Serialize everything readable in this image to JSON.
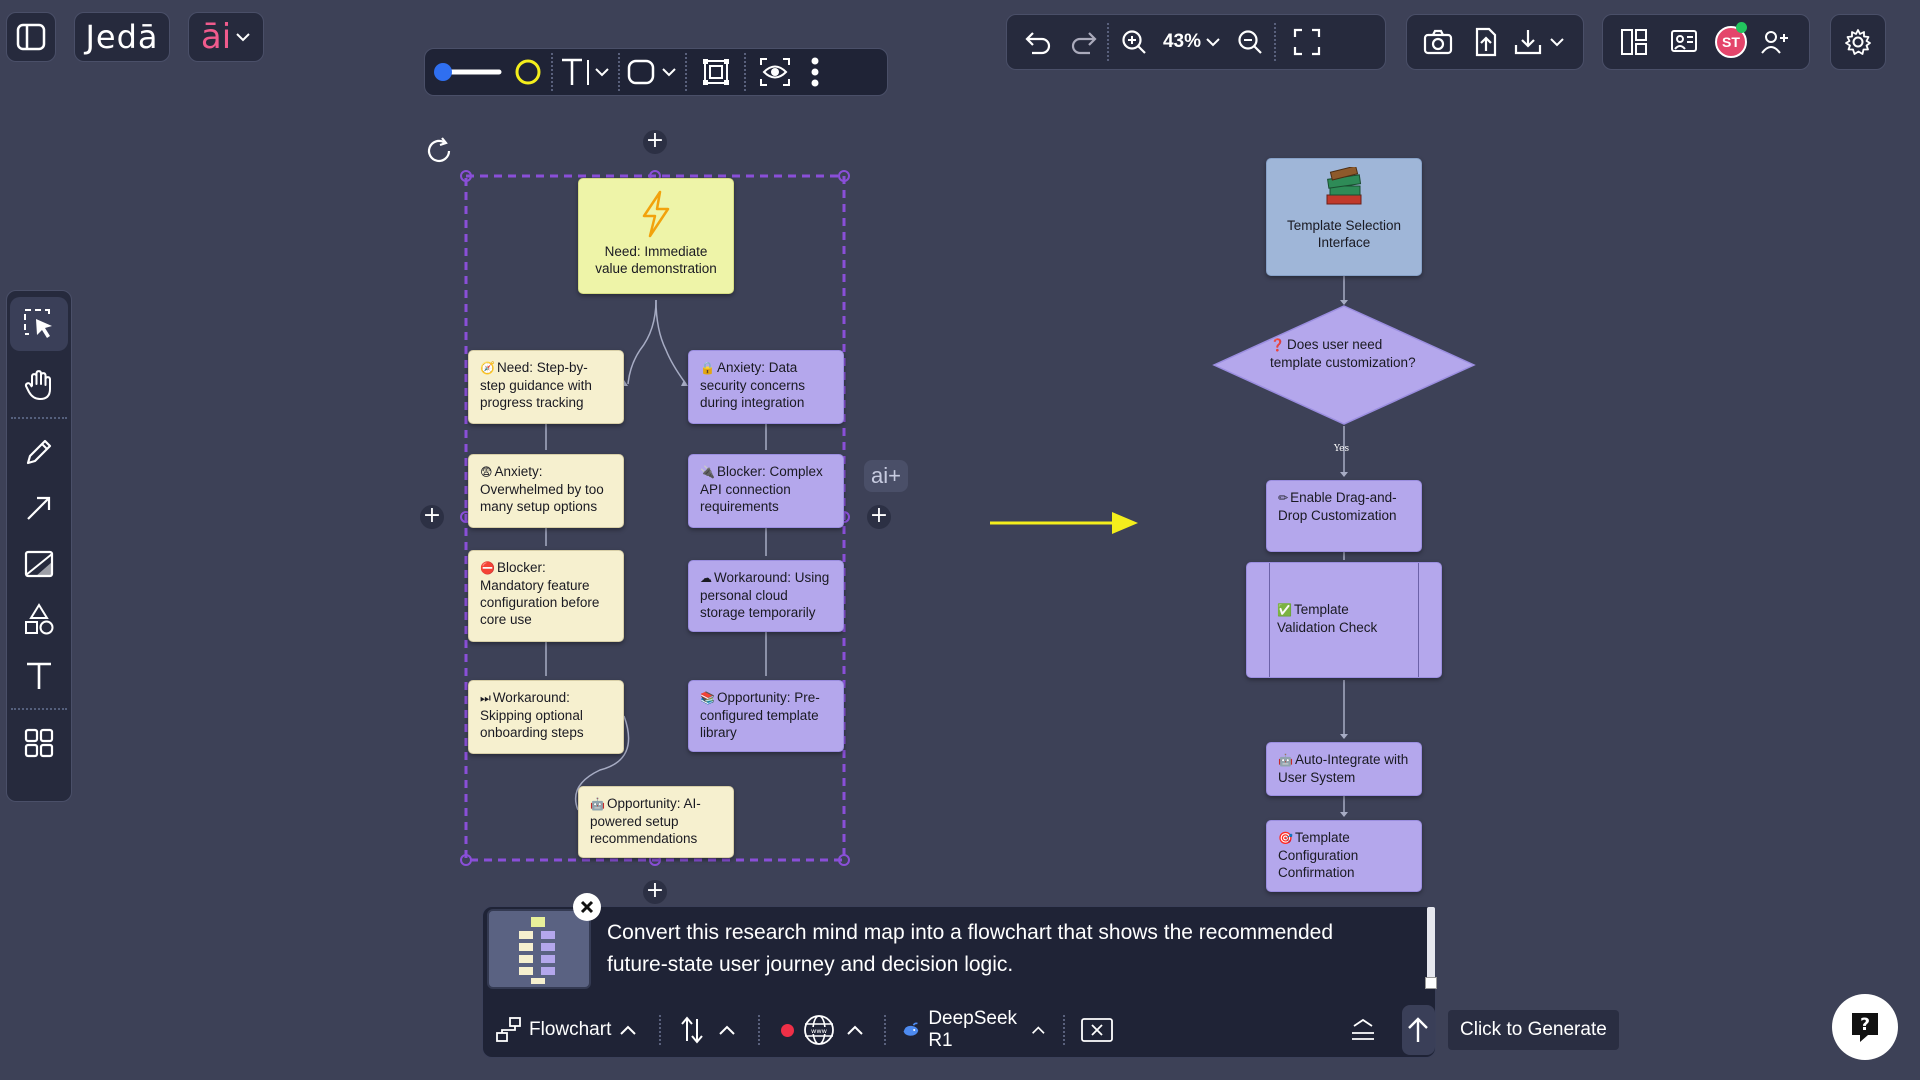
{
  "app": {
    "logo": "Jedā",
    "ai_badge": "āi"
  },
  "top_toolbar": {
    "zoom_level": "43%"
  },
  "avatar": {
    "initials": "ST"
  },
  "left_tools": [
    {
      "name": "select-tool",
      "icon": "select-icon"
    },
    {
      "name": "hand-tool",
      "icon": "hand-icon"
    },
    {
      "name": "pencil-tool",
      "icon": "pencil-icon"
    },
    {
      "name": "arrow-tool",
      "icon": "arrow-icon"
    },
    {
      "name": "image-tool",
      "icon": "image-icon"
    },
    {
      "name": "shapes-tool",
      "icon": "shapes-icon"
    },
    {
      "name": "text-tool",
      "icon": "text-icon"
    },
    {
      "name": "apps-tool",
      "icon": "grid-icon"
    }
  ],
  "mindmap": {
    "root": "Need: Immediate value demonstration",
    "left": [
      {
        "emoji": "🧭",
        "text": "Need: Step-by-step guidance with progress tracking"
      },
      {
        "emoji": "😨",
        "text": "Anxiety: Overwhelmed by too many setup options"
      },
      {
        "emoji": "⛔",
        "text": "Blocker: Mandatory feature configuration before core use"
      },
      {
        "emoji": "⏭",
        "text": "Workaround: Skipping optional onboarding steps"
      }
    ],
    "right": [
      {
        "emoji": "🔒",
        "text": "Anxiety: Data security concerns during integration"
      },
      {
        "emoji": "🔌",
        "text": "Blocker: Complex API connection requirements"
      },
      {
        "emoji": "☁",
        "text": "Workaround: Using personal cloud storage temporarily"
      },
      {
        "emoji": "📚",
        "text": "Opportunity: Pre-configured template library"
      }
    ],
    "bottom": {
      "emoji": "🤖",
      "text": "Opportunity: AI-powered setup recommendations"
    },
    "ai_plus": "ai+"
  },
  "flowchart": {
    "start": "Template Selection Interface",
    "decision": {
      "emoji": "❓",
      "text": "Does user need template customization?"
    },
    "yes_label": "Yes",
    "steps": [
      {
        "emoji": "✏",
        "text": "Enable Drag-and-Drop Customization"
      },
      {
        "emoji": "✅",
        "text": "Template Validation Check"
      },
      {
        "emoji": "🤖",
        "text": "Auto-Integrate with User System"
      },
      {
        "emoji": "🎯",
        "text": "Template Configuration Confirmation"
      }
    ]
  },
  "prompt": {
    "text": "Convert this research mind map into a flowchart that shows the recommended future-state user journey and decision logic.",
    "diagram_type": "Flowchart",
    "model": "DeepSeek R1",
    "generate_tooltip": "Click to Generate"
  },
  "colors": {
    "background": "#3d4157",
    "selection": "#8a4fd8",
    "arrow": "#f4ee1c",
    "accent_pink": "#f05b8d"
  }
}
